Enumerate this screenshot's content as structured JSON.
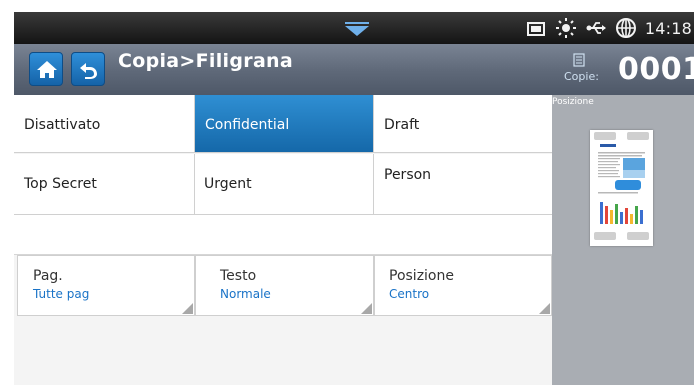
{
  "status_bar": {
    "time": "14:18",
    "icons": [
      "menu-chevron-icon",
      "tray-icon",
      "brightness-icon",
      "usb-icon",
      "globe-icon"
    ]
  },
  "header": {
    "title": "Copia>Filigrana",
    "copies_label": "Copie:",
    "copies_count": "0001"
  },
  "watermark_options": [
    {
      "label": "Disattivato",
      "selected": false
    },
    {
      "label": "Confidential",
      "selected": true
    },
    {
      "label": "Draft",
      "selected": false
    },
    {
      "label": "Top Secret",
      "selected": false
    },
    {
      "label": "Urgent",
      "selected": false
    },
    {
      "label": "Person",
      "selected": false
    }
  ],
  "settings": [
    {
      "label": "Pag.",
      "value": "Tutte pag"
    },
    {
      "label": "Testo",
      "value": "Normale"
    },
    {
      "label": "Posizione",
      "value": "Centro"
    }
  ],
  "preview": {
    "label": "Posizione"
  },
  "colors": {
    "accent": "#1a73c7",
    "selected_bg": "#1f7cc4",
    "header_bg": "#5e6878",
    "panel_bg": "#a9adb3"
  }
}
